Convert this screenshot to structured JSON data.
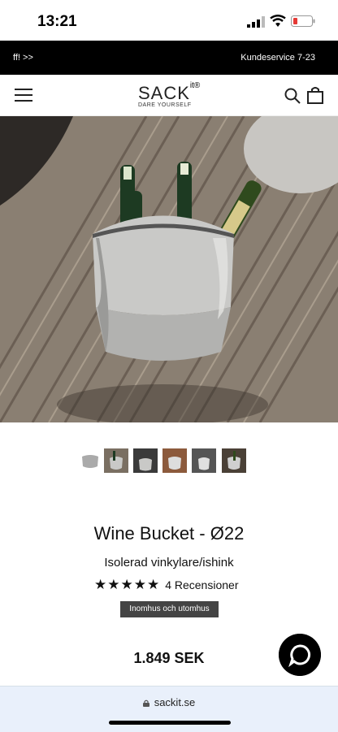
{
  "status": {
    "time": "13:21"
  },
  "promo": {
    "left_text": "ff! >>",
    "right_text": "Kundeservice 7-23"
  },
  "header": {
    "brand": "SACK",
    "brand_suffix": "it",
    "tagline": "DARE YOURSELF"
  },
  "product": {
    "title": "Wine Bucket - Ø22",
    "subtitle": "Isolerad vinkylare/ishink",
    "stars": "★★★★★",
    "rating_value": 5,
    "reviews": "4 Recensioner",
    "badge": "Inomhus och utomhus",
    "price": "1.849 SEK"
  },
  "thumbnails": [
    "thumb-1",
    "thumb-2",
    "thumb-3",
    "thumb-4",
    "thumb-5",
    "thumb-6"
  ],
  "browser": {
    "url": "sackit.se"
  },
  "colors": {
    "promo_bg": "#000000",
    "badge_bg": "#444444",
    "chat_bg": "#000000",
    "urlbar_bg": "#e9f0fb"
  }
}
